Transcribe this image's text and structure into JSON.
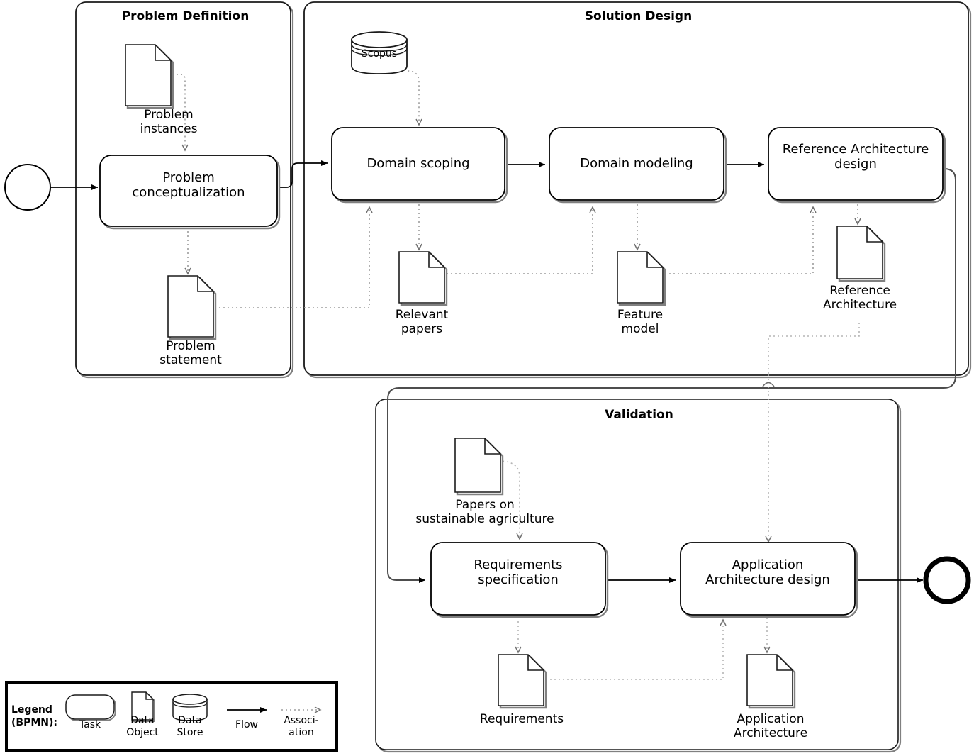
{
  "diagram": {
    "notation": "BPMN",
    "pools": [
      {
        "id": "problem_definition",
        "title": "Problem Definition"
      },
      {
        "id": "solution_design",
        "title": "Solution Design"
      },
      {
        "id": "validation",
        "title": "Validation"
      }
    ],
    "tasks": [
      {
        "id": "problem_conceptualization",
        "label": "Problem\nconceptualization"
      },
      {
        "id": "domain_scoping",
        "label": "Domain scoping"
      },
      {
        "id": "domain_modeling",
        "label": "Domain modeling"
      },
      {
        "id": "reference_architecture_design",
        "label": "Reference Architecture\ndesign"
      },
      {
        "id": "requirements_specification",
        "label": "Requirements\nspecification"
      },
      {
        "id": "application_architecture_design",
        "label": "Application\nArchitecture design"
      }
    ],
    "data_objects": [
      {
        "id": "problem_instances",
        "label": "Problem\ninstances"
      },
      {
        "id": "problem_statement",
        "label": "Problem\nstatement"
      },
      {
        "id": "relevant_papers",
        "label": "Relevant\npapers"
      },
      {
        "id": "feature_model",
        "label": "Feature\nmodel"
      },
      {
        "id": "reference_architecture",
        "label": "Reference\nArchitecture"
      },
      {
        "id": "papers_on_sustainable_agriculture",
        "label": "Papers on\nsustainable agriculture"
      },
      {
        "id": "requirements",
        "label": "Requirements"
      },
      {
        "id": "application_architecture",
        "label": "Application\nArchitecture"
      }
    ],
    "data_stores": [
      {
        "id": "scopus",
        "label": "Scopus"
      }
    ],
    "events": [
      {
        "id": "start_event",
        "type": "start"
      },
      {
        "id": "end_event",
        "type": "end"
      }
    ]
  },
  "legend": {
    "title": "Legend\n(BPMN):",
    "items": [
      {
        "id": "task",
        "label": "Task"
      },
      {
        "id": "data_object",
        "label": "Data\nObject"
      },
      {
        "id": "data_store",
        "label": "Data\nStore"
      },
      {
        "id": "flow",
        "label": "Flow"
      },
      {
        "id": "association",
        "label": "Associ-\nation"
      }
    ]
  },
  "colors": {
    "stroke": "#000000",
    "shadow": "#808080",
    "association": "#a6a6a6",
    "background": "#ffffff"
  }
}
